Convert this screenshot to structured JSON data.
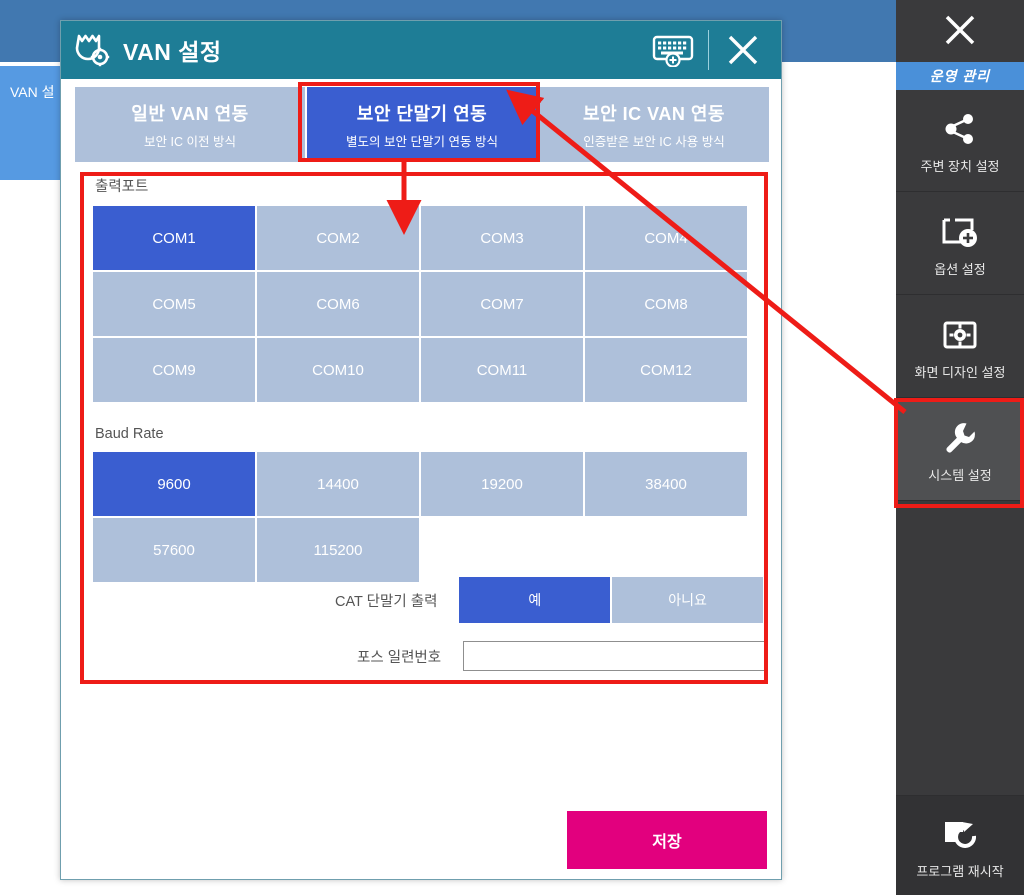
{
  "background": {
    "tab_label": "VAN 설"
  },
  "dialog": {
    "title": "VAN 설정",
    "keyboard_icon": "keyboard-add-icon",
    "close_icon": "close-icon",
    "shield_gear_icon": "shield-gear-icon",
    "tabs": [
      {
        "main": "일반 VAN 연동",
        "sub": "보안 IC 이전 방식",
        "selected": false
      },
      {
        "main": "보안 단말기 연동",
        "sub": "별도의 보안 단말기 연동 방식",
        "selected": true
      },
      {
        "main": "보안 IC VAN 연동",
        "sub": "인증받은 보안 IC 사용 방식",
        "selected": false
      }
    ],
    "output_port": {
      "label": "출력포트",
      "options": [
        "COM1",
        "COM2",
        "COM3",
        "COM4",
        "COM5",
        "COM6",
        "COM7",
        "COM8",
        "COM9",
        "COM10",
        "COM11",
        "COM12"
      ],
      "selected": "COM1"
    },
    "baud_rate": {
      "label": "Baud Rate",
      "options": [
        "9600",
        "14400",
        "19200",
        "38400",
        "57600",
        "115200"
      ],
      "selected": "9600"
    },
    "cat_output": {
      "label": "CAT 단말기 출력",
      "yes": "예",
      "no": "아니요",
      "selected": "예"
    },
    "pos_serial": {
      "label": "포스 일련번호",
      "value": "",
      "placeholder": ""
    },
    "save_label": "저장"
  },
  "sidebar": {
    "close_icon": "close-icon",
    "section_title": "운영 관리",
    "items": [
      {
        "label": "주변 장치 설정",
        "icon": "share-nodes-icon",
        "active": false
      },
      {
        "label": "옵션 설정",
        "icon": "add-device-icon",
        "active": false
      },
      {
        "label": "화면 디자인 설정",
        "icon": "screen-gear-icon",
        "active": false
      },
      {
        "label": "시스템 설정",
        "icon": "wrench-icon",
        "active": true
      }
    ],
    "restart": {
      "label": "프로그램 재시작",
      "icon": "restart-program-icon"
    }
  },
  "colors": {
    "dialog_title_bar": "#1e7d96",
    "selected_blue": "#3a5ed0",
    "unselected_blue": "#aec0da",
    "save_magenta": "#e2007e",
    "sidebar_dark": "#3a3a3c",
    "sidebar_section_blue": "#4a90d9",
    "annotation_red": "#ee1c17",
    "bg_header_blue": "#4178b0"
  }
}
